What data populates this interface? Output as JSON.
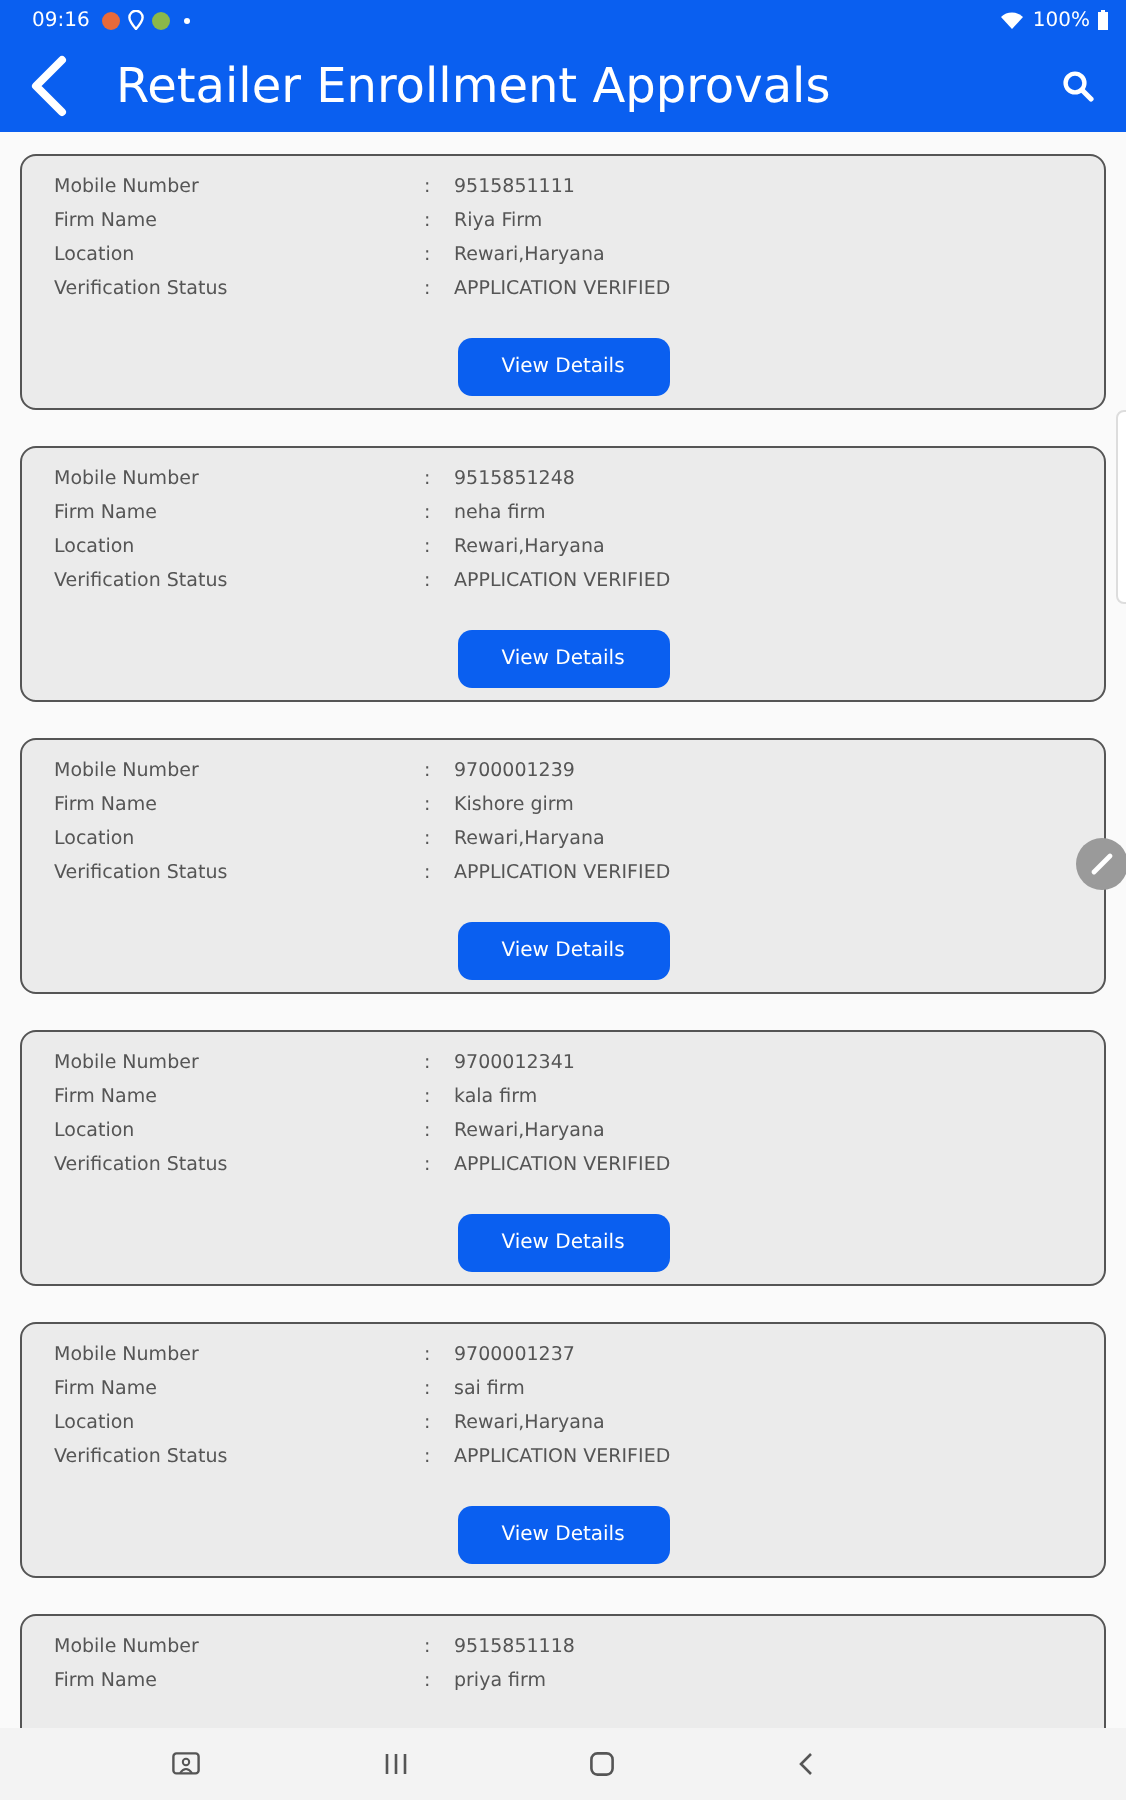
{
  "status_bar": {
    "time": "09:16",
    "battery": "100%"
  },
  "app_bar": {
    "title": "Retailer Enrollment Approvals"
  },
  "cards": [
    {
      "fields": [
        {
          "label": "Mobile Number",
          "separator": ":",
          "value": "9515851111"
        },
        {
          "label": "Firm Name",
          "separator": ":",
          "value": "Riya Firm"
        },
        {
          "label": "Location",
          "separator": ":",
          "value": "Rewari,Haryana"
        },
        {
          "label": "Verification Status",
          "separator": ":",
          "value": "APPLICATION VERIFIED"
        }
      ],
      "button": "View Details"
    },
    {
      "fields": [
        {
          "label": "Mobile Number",
          "separator": ":",
          "value": "9515851248"
        },
        {
          "label": "Firm Name",
          "separator": ":",
          "value": "neha firm"
        },
        {
          "label": "Location",
          "separator": ":",
          "value": "Rewari,Haryana"
        },
        {
          "label": "Verification Status",
          "separator": ":",
          "value": "APPLICATION VERIFIED"
        }
      ],
      "button": "View Details"
    },
    {
      "fields": [
        {
          "label": "Mobile Number",
          "separator": ":",
          "value": "9700001239"
        },
        {
          "label": "Firm Name",
          "separator": ":",
          "value": "Kishore girm"
        },
        {
          "label": "Location",
          "separator": ":",
          "value": "Rewari,Haryana"
        },
        {
          "label": "Verification Status",
          "separator": ":",
          "value": "APPLICATION VERIFIED"
        }
      ],
      "button": "View Details"
    },
    {
      "fields": [
        {
          "label": "Mobile Number",
          "separator": ":",
          "value": "9700012341"
        },
        {
          "label": "Firm Name",
          "separator": ":",
          "value": "kala firm"
        },
        {
          "label": "Location",
          "separator": ":",
          "value": "Rewari,Haryana"
        },
        {
          "label": "Verification Status",
          "separator": ":",
          "value": "APPLICATION VERIFIED"
        }
      ],
      "button": "View Details"
    },
    {
      "fields": [
        {
          "label": "Mobile Number",
          "separator": ":",
          "value": "9700001237"
        },
        {
          "label": "Firm Name",
          "separator": ":",
          "value": "sai firm"
        },
        {
          "label": "Location",
          "separator": ":",
          "value": "Rewari,Haryana"
        },
        {
          "label": "Verification Status",
          "separator": ":",
          "value": "APPLICATION VERIFIED"
        }
      ],
      "button": "View Details"
    },
    {
      "fields": [
        {
          "label": "Mobile Number",
          "separator": ":",
          "value": "9515851118"
        },
        {
          "label": "Firm Name",
          "separator": ":",
          "value": "priya firm"
        }
      ]
    }
  ]
}
